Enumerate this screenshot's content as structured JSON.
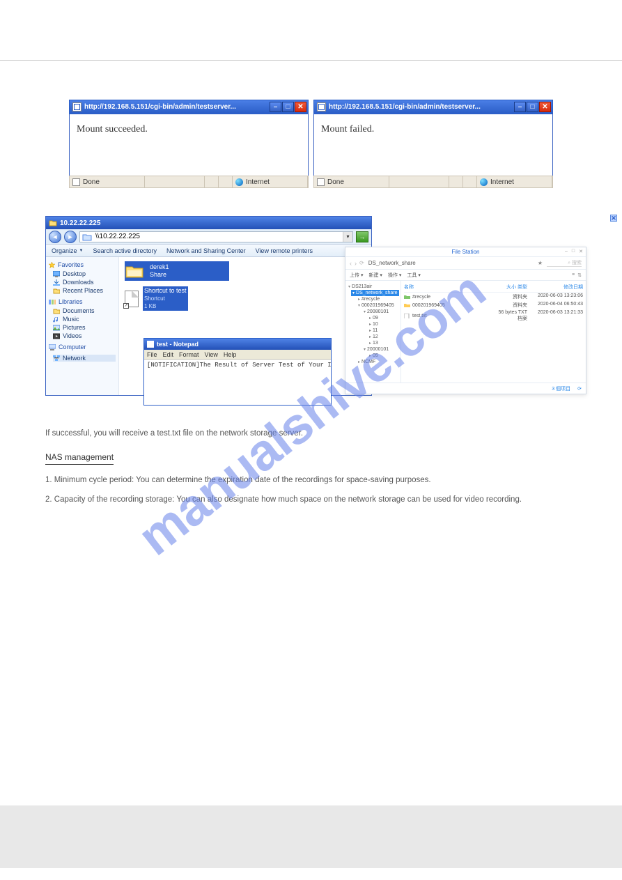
{
  "ie_popups": {
    "left": {
      "url": "http://192.168.5.151/cgi-bin/admin/testserver...",
      "body": "Mount succeeded.",
      "done": "Done",
      "zone": "Internet"
    },
    "right": {
      "url": "http://192.168.5.151/cgi-bin/admin/testserver...",
      "body": "Mount failed.",
      "done": "Done",
      "zone": "Internet"
    }
  },
  "explorer": {
    "title_ip": "10.22.22.225",
    "address": "\\\\10.22.22.225",
    "toolbar": {
      "organize": "Organize",
      "search_ad": "Search active directory",
      "net_center": "Network and Sharing Center",
      "view_printers": "View remote printers"
    },
    "tree": {
      "fav_hdr": "Favorites",
      "fav_items": [
        "Desktop",
        "Downloads",
        "Recent Places"
      ],
      "lib_hdr": "Libraries",
      "lib_items": [
        "Documents",
        "Music",
        "Pictures",
        "Videos"
      ],
      "computer": "Computer",
      "network": "Network"
    },
    "tiles": {
      "folder": {
        "line1": "derek1",
        "line2": "Share"
      },
      "shortcut": {
        "line1": "Shortcut to test",
        "line2": "Shortcut",
        "line3": "1 KB"
      }
    }
  },
  "notepad": {
    "title": "test - Notepad",
    "menu": [
      "File",
      "Edit",
      "Format",
      "View",
      "Help"
    ],
    "body": "[NOTIFICATION]The Result of Server Test of Your IP Cam"
  },
  "filestation": {
    "title": "File Station",
    "crumb": "DS_network_share",
    "search_hint": "搜索",
    "toolbar": [
      "上传 ▾",
      "新建 ▾",
      "操作 ▾",
      "工具 ▾"
    ],
    "tree": {
      "root": "DS213air",
      "sel": "DS_network_share",
      "items_l1": "#recycle",
      "items_l2": "000201969405",
      "items_l3": "20080101",
      "leaves": [
        "09",
        "10",
        "11",
        "12",
        "13"
      ],
      "items_l4": "20000101",
      "items_l5": "05",
      "items_l6": "NCMF"
    },
    "cols": {
      "c1": "名称",
      "c2": "大小  类型",
      "c3": "修改日期"
    },
    "rows": [
      {
        "name": "#recycle",
        "size_type": "资料夹",
        "date": "2020-06-03 13:23:06"
      },
      {
        "name": "000201969405",
        "size_type": "资料夹",
        "date": "2020-06-04 06:50:43"
      },
      {
        "name": "test.txt",
        "size_type": "56 bytes   TXT 档案",
        "date": "2020-06-03 13:21:33"
      }
    ],
    "footer": {
      "items": "3 個项目",
      "reload": "⟳"
    }
  },
  "body_text": {
    "p1": "If successful, you will receive a test.txt file on the network storage server.",
    "section": "NAS management",
    "p2": "1. Minimum cycle period: You can determine the expiration date of the recordings for space-saving purposes.",
    "p3": "2. Capacity of the recording storage: You can also designate how much space on the network storage can be used for video recording."
  },
  "watermark": "manualshive.com"
}
